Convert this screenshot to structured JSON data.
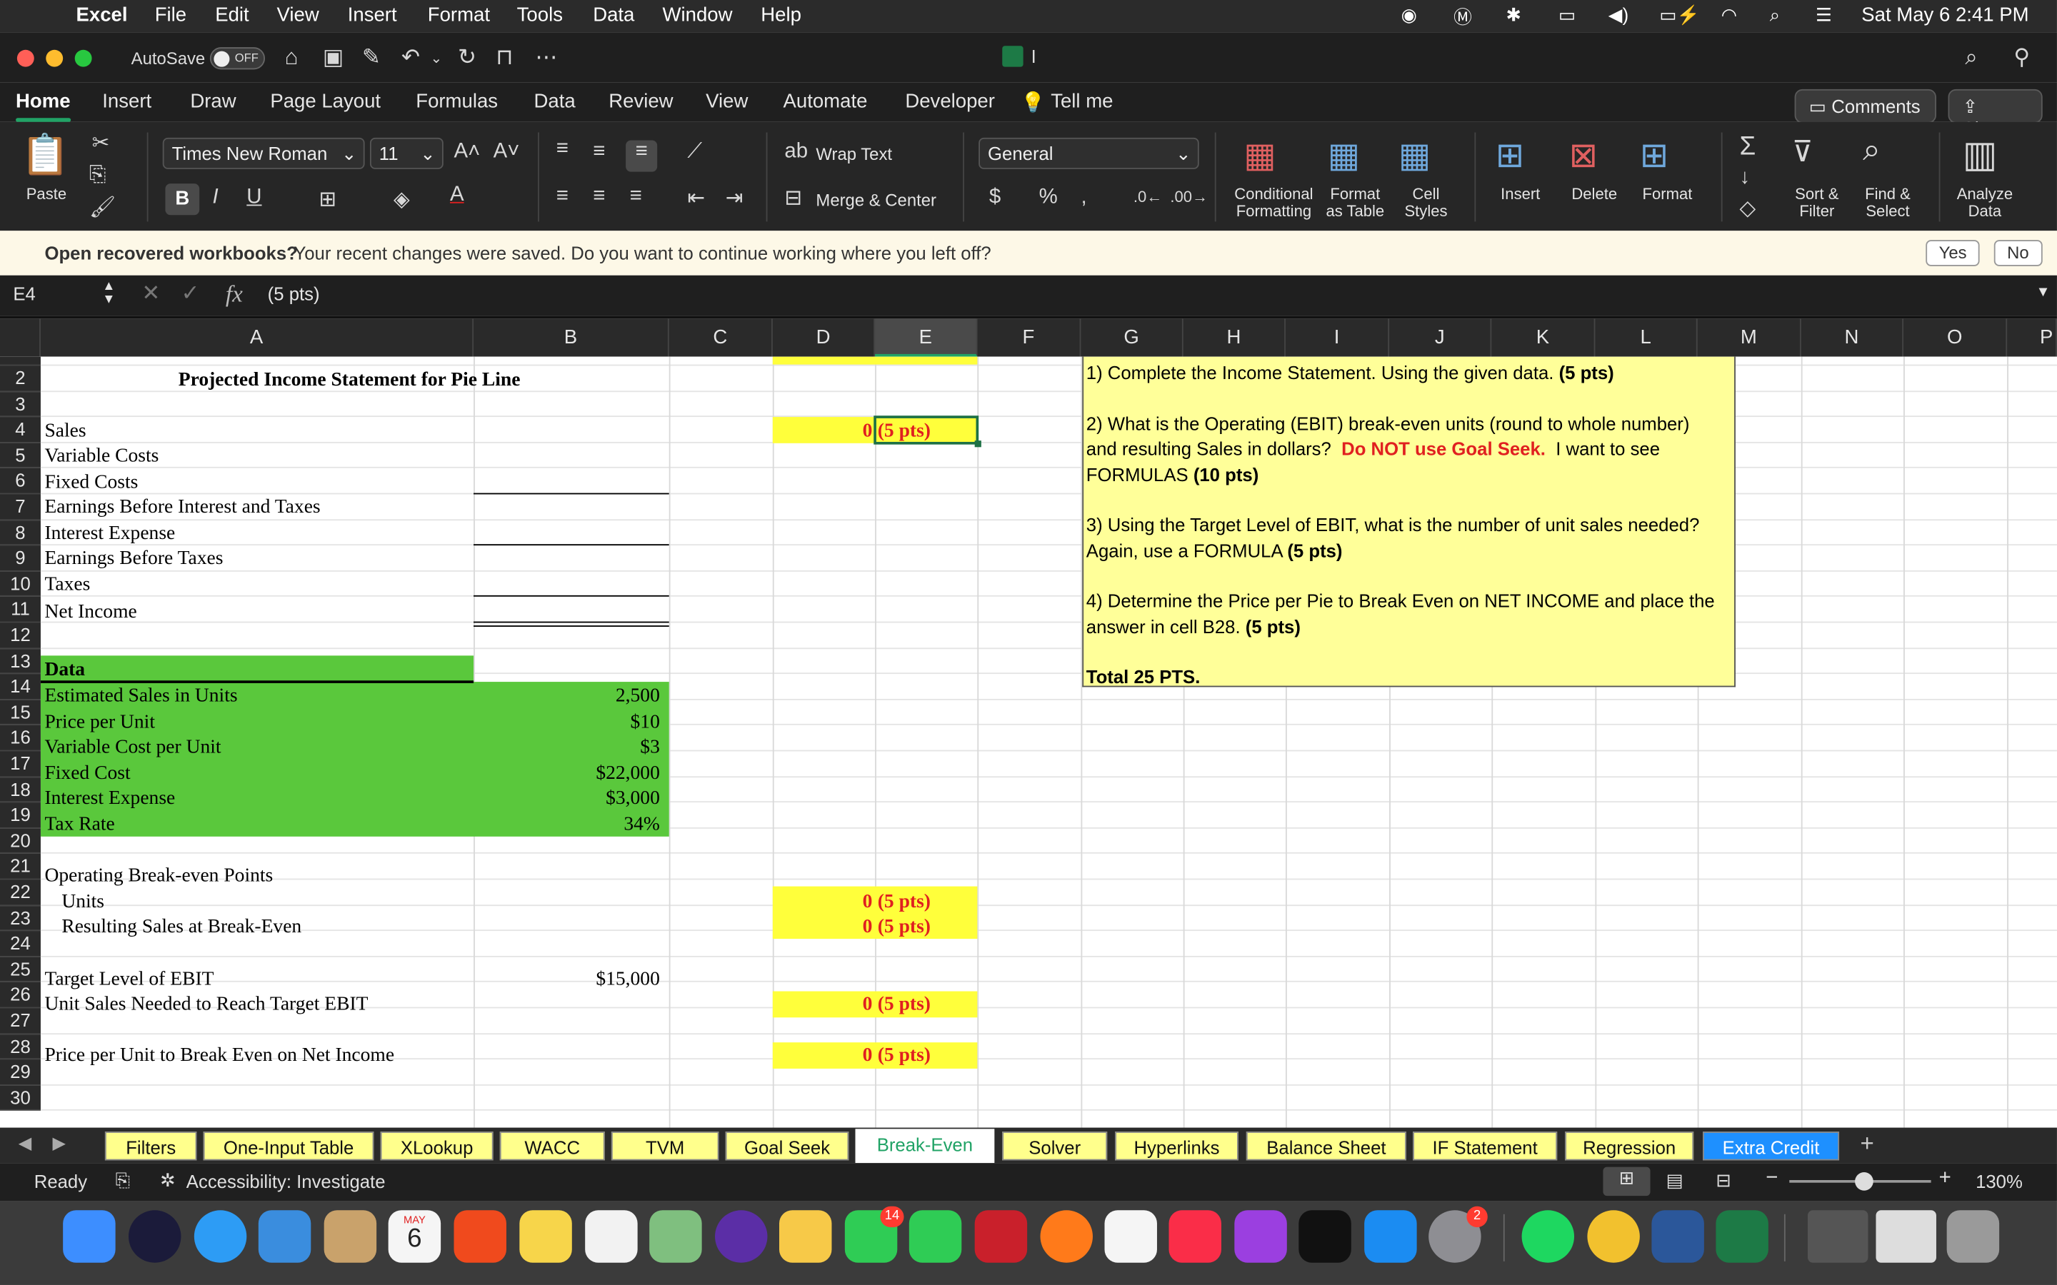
{
  "menubar": {
    "app": "Excel",
    "items": [
      "File",
      "Edit",
      "View",
      "Insert",
      "Format",
      "Tools",
      "Data",
      "Window",
      "Help"
    ],
    "datetime": "Sat May 6  2:41 PM"
  },
  "titlebar": {
    "autosave": "AutoSave",
    "toggle": "OFF",
    "doc_title": "I"
  },
  "ribbon_tabs": {
    "items": [
      "Home",
      "Insert",
      "Draw",
      "Page Layout",
      "Formulas",
      "Data",
      "Review",
      "View",
      "Automate",
      "Developer"
    ],
    "tell_me": "Tell me",
    "comments": "Comments",
    "share": "Share"
  },
  "ribbon": {
    "paste": "Paste",
    "font_name": "Times New Roman",
    "font_size": "11",
    "wrap_text": "Wrap Text",
    "merge_center": "Merge & Center",
    "number_format": "General",
    "conditional": [
      "Conditional",
      "Formatting"
    ],
    "format_table": [
      "Format",
      "as Table"
    ],
    "cell_styles": [
      "Cell",
      "Styles"
    ],
    "insert": "Insert",
    "delete": "Delete",
    "format": "Format",
    "sort_filter": [
      "Sort &",
      "Filter"
    ],
    "find_select": [
      "Find &",
      "Select"
    ],
    "analyze": [
      "Analyze",
      "Data"
    ]
  },
  "notification": {
    "message": "Open recovered workbooks?",
    "detail": "Your recent changes were saved. Do you want to continue working where you left off?",
    "yes": "Yes",
    "no": "No"
  },
  "formula_bar": {
    "name_box": "E4",
    "fx": "fx",
    "formula": "(5 pts)"
  },
  "columns": [
    "A",
    "B",
    "C",
    "D",
    "E",
    "F",
    "G",
    "H",
    "I",
    "J",
    "K",
    "L",
    "M",
    "N",
    "O",
    "P"
  ],
  "rows": [
    "",
    "2",
    "3",
    "4",
    "5",
    "6",
    "7",
    "8",
    "9",
    "10",
    "11",
    "12",
    "13",
    "14",
    "15",
    "16",
    "17",
    "18",
    "19",
    "20",
    "21",
    "22",
    "23",
    "24",
    "25",
    "26",
    "27",
    "28",
    "29",
    "30"
  ],
  "sheet": {
    "title": "Projected Income Statement for Pie Line",
    "labels": {
      "r4": "Sales",
      "r5": "Variable Costs",
      "r6": "Fixed Costs",
      "r7": "Earnings Before Interest and Taxes",
      "r8": "Interest Expense",
      "r9": "Earnings Before Taxes",
      "r10": "Taxes",
      "r11": "Net Income",
      "r13": "Data",
      "r14": "Estimated Sales in Units",
      "r15": "Price per Unit",
      "r16": "Variable Cost per Unit",
      "r17": "Fixed Cost",
      "r18": "Interest Expense",
      "r19": "Tax Rate",
      "r21": "Operating Break-even Points",
      "r22": "Units",
      "r23": "Resulting Sales at Break-Even",
      "r25": "Target Level of EBIT",
      "r26": "Unit Sales Needed to Reach Target EBIT",
      "r28": "Price per Unit to Break Even on Net Income"
    },
    "values": {
      "b14": "2,500",
      "b15": "$10",
      "b16": "$3",
      "b17": "$22,000",
      "b18": "$3,000",
      "b19": "34%",
      "b25": "$15,000"
    },
    "answers": {
      "zero": "0",
      "pts": "(5 pts)"
    },
    "instructions": {
      "q1": "1) Complete the Income Statement. Using the given data.",
      "q1_pts": "(5 pts)",
      "q2a": "2) What is the Operating (EBIT) break-even units (round to whole number)",
      "q2b": "and resulting Sales in dollars?",
      "q2_warn": "Do NOT use Goal Seek.",
      "q2c": "I want to see",
      "q2d": "FORMULAS",
      "q2_pts": "(10 pts)",
      "q3a": "3)  Using the Target Level of EBIT, what is the number of unit sales needed?",
      "q3b": "Again, use a FORMULA",
      "q3_pts": "(5 pts)",
      "q4a": "4)  Determine the Price per Pie to Break Even on NET INCOME and place the",
      "q4b": "answer in cell B28.",
      "q4_pts": "(5 pts)",
      "total": "Total 25 PTS."
    }
  },
  "sheet_tabs": [
    "Filters",
    "One-Input Table",
    "XLookup",
    "WACC",
    "TVM",
    "Goal Seek",
    "Break-Even",
    "Solver",
    "Hyperlinks",
    "Balance Sheet",
    "IF Statement",
    "Regression",
    "Extra Credit"
  ],
  "status": {
    "ready": "Ready",
    "accessibility": "Accessibility: Investigate",
    "zoom": "130%"
  },
  "dock": {
    "calendar_month": "MAY",
    "calendar_day": "6",
    "messages_badge": "14",
    "settings_badge": "2"
  },
  "colors": {
    "accent": "#21a366",
    "green_fill": "#5ac83c",
    "yellow_fill": "#ffff3b",
    "instruction_fill": "#ffff99",
    "red_text": "#e02020",
    "selected_tab": "#ffffff"
  }
}
